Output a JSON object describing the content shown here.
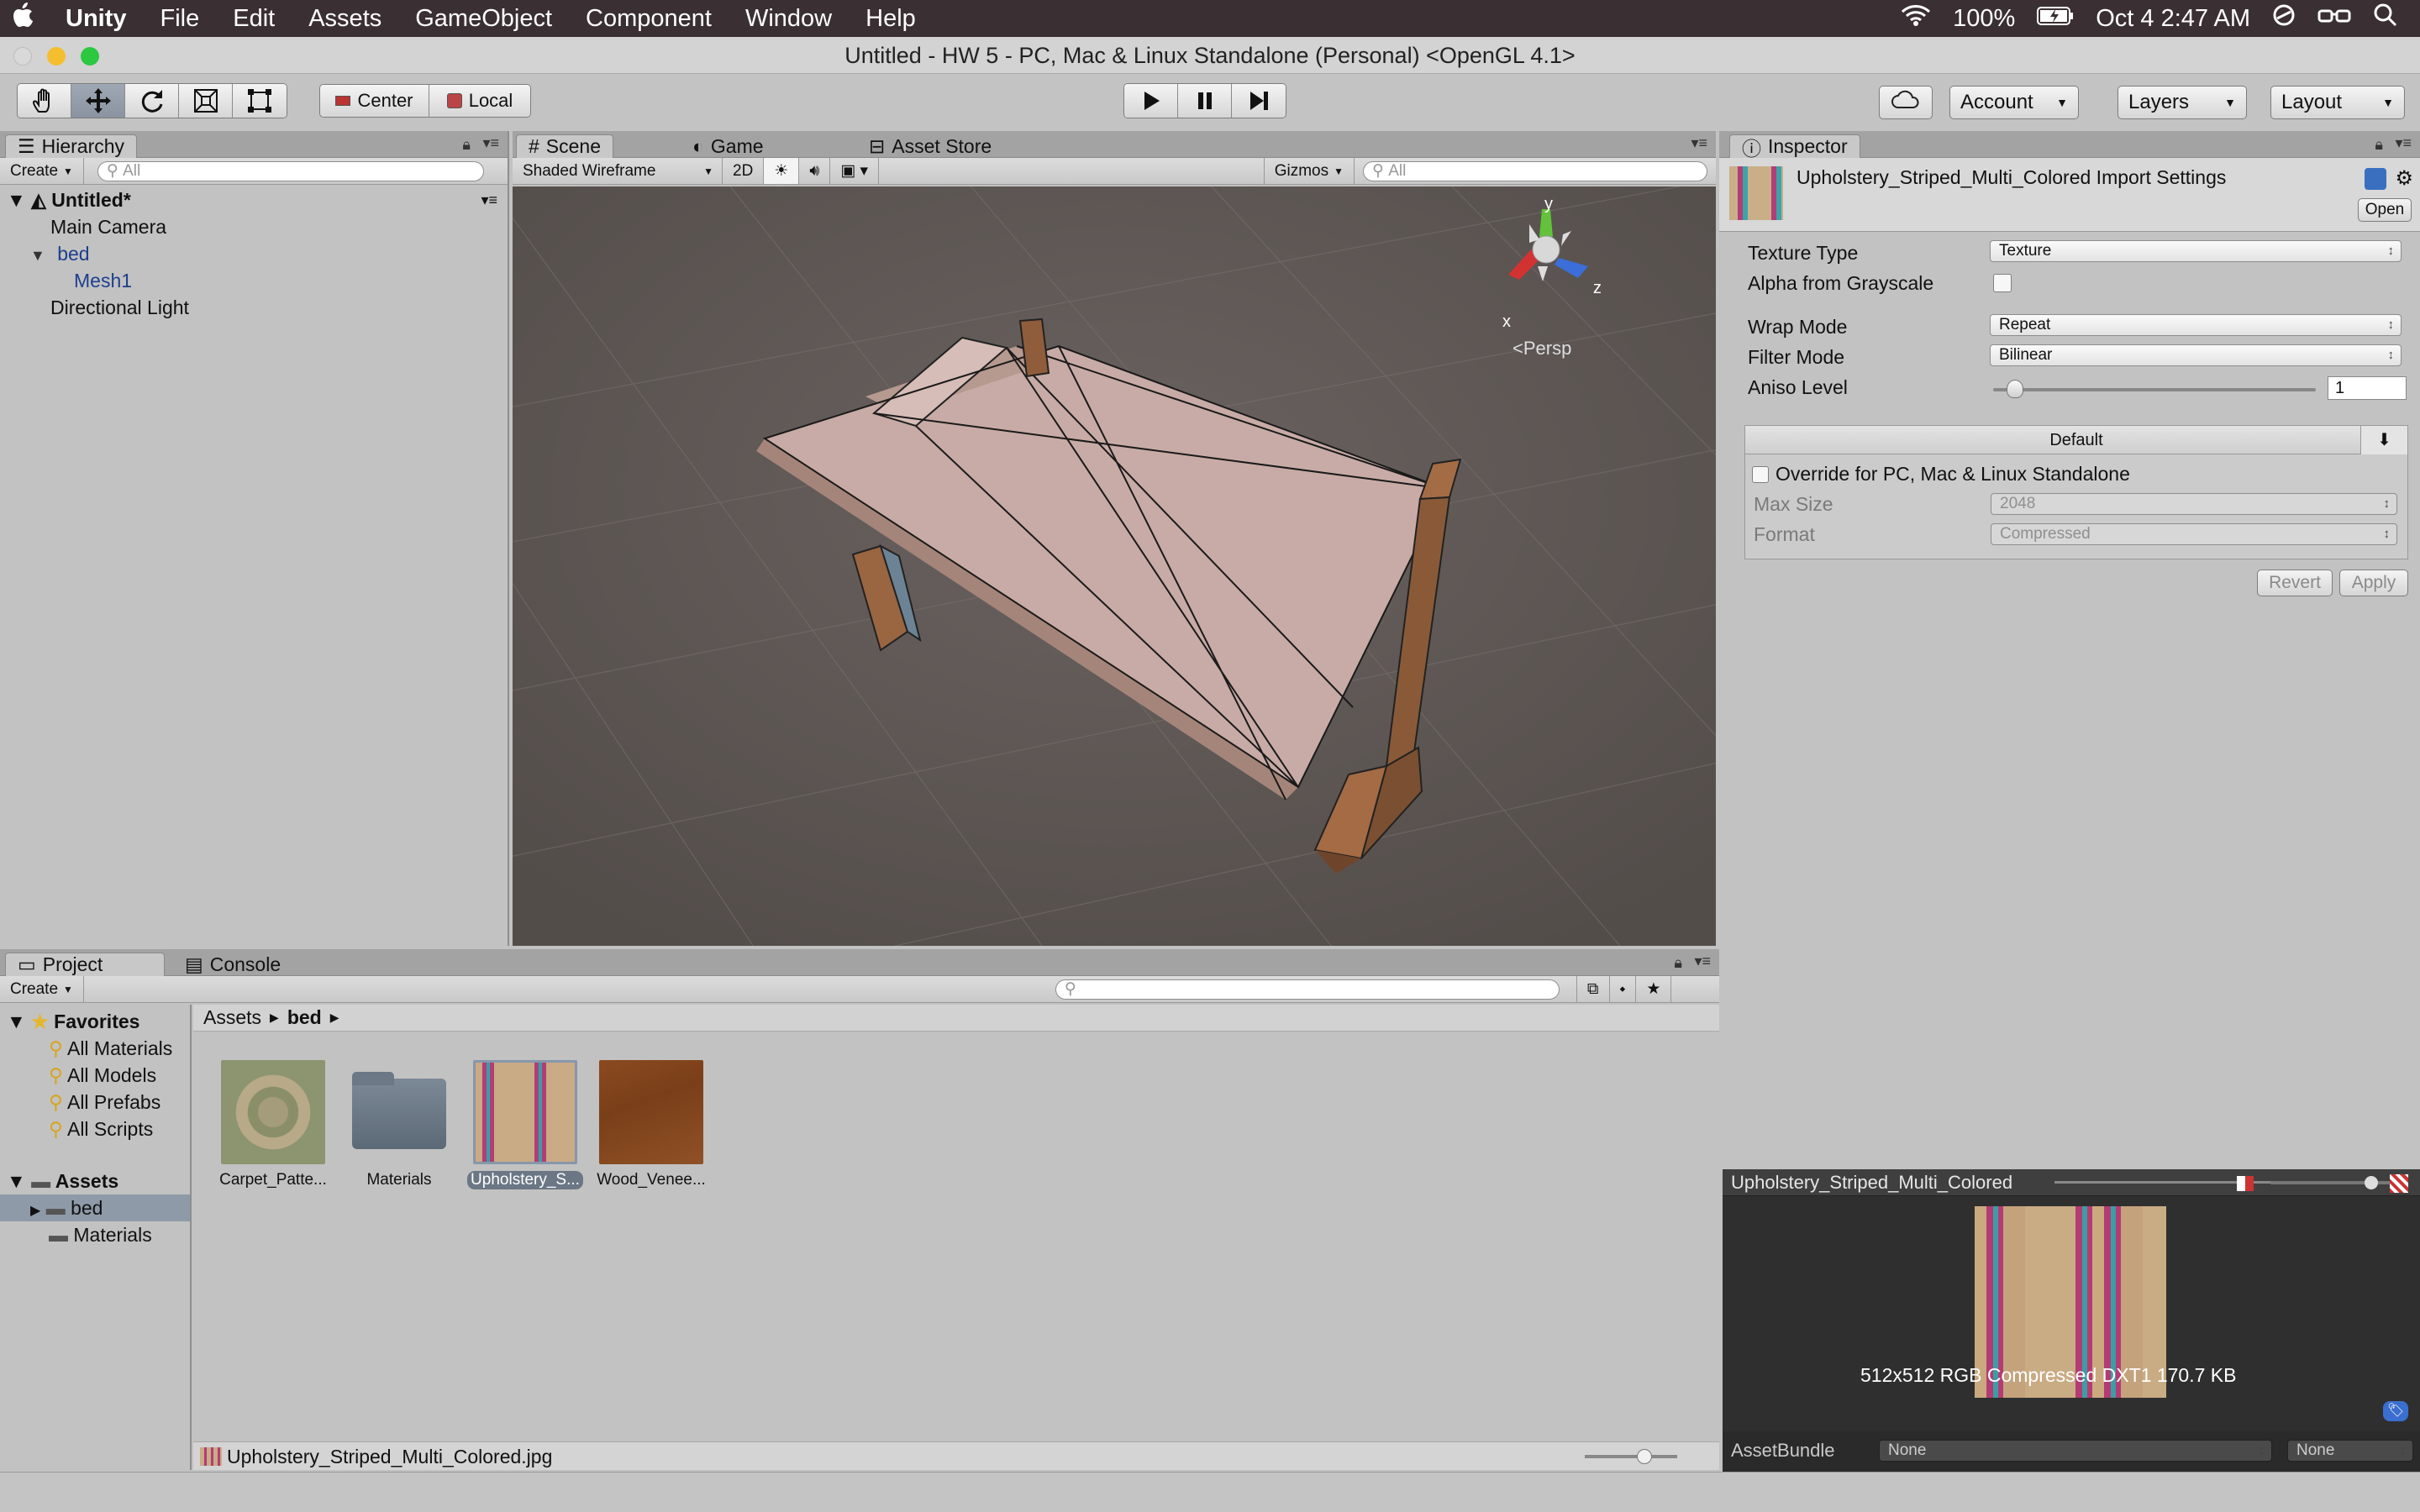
{
  "menubar": {
    "apple": "",
    "app": "Unity",
    "items": [
      "File",
      "Edit",
      "Assets",
      "GameObject",
      "Component",
      "Window",
      "Help"
    ],
    "battery": "100%",
    "clock": "Oct 4  2:47 AM"
  },
  "window": {
    "title": "Untitled - HW 5 - PC, Mac & Linux Standalone (Personal) <OpenGL 4.1>"
  },
  "toolbar": {
    "center_label": "Center",
    "local_label": "Local",
    "account_label": "Account",
    "layers_label": "Layers",
    "layout_label": "Layout"
  },
  "hierarchy": {
    "tab": "Hierarchy",
    "create": "Create",
    "search_placeholder": "All",
    "scene": "Untitled*",
    "items": {
      "main_camera": "Main Camera",
      "bed": "bed",
      "mesh1": "Mesh1",
      "light": "Directional Light"
    }
  },
  "scene": {
    "tabs": {
      "scene": "Scene",
      "game": "Game",
      "store": "Asset Store"
    },
    "shading": "Shaded Wireframe",
    "mode2d": "2D",
    "gizmos": "Gizmos",
    "search_placeholder": "All",
    "gizmo": {
      "y": "y",
      "x": "x",
      "z": "z",
      "persp": "Persp"
    }
  },
  "inspector": {
    "tab": "Inspector",
    "title": "Upholstery_Striped_Multi_Colored  Import Settings",
    "open": "Open",
    "texture_type_label": "Texture Type",
    "texture_type_value": "Texture",
    "alpha_label": "Alpha from Grayscale",
    "wrap_label": "Wrap Mode",
    "wrap_value": "Repeat",
    "filter_label": "Filter Mode",
    "filter_value": "Bilinear",
    "aniso_label": "Aniso Level",
    "aniso_value": "1",
    "platform_header": "Default",
    "override_label": "Override for PC, Mac & Linux Standalone",
    "max_size_label": "Max Size",
    "max_size_value": "2048",
    "format_label": "Format",
    "format_value": "Compressed",
    "revert": "Revert",
    "apply": "Apply"
  },
  "preview": {
    "title": "Upholstery_Striped_Multi_Colored",
    "info": "512x512  RGB Compressed DXT1    170.7 KB",
    "assetbundle_label": "AssetBundle",
    "bundle_value": "None",
    "variant_value": "None"
  },
  "project": {
    "tabs": {
      "project": "Project",
      "console": "Console"
    },
    "create": "Create",
    "favorites": "Favorites",
    "fav_items": [
      "All Materials",
      "All Models",
      "All Prefabs",
      "All Scripts"
    ],
    "assets_root": "Assets",
    "asset_folders": [
      "bed",
      "Materials"
    ],
    "breadcrumb": {
      "root": "Assets",
      "current": "bed"
    },
    "assets": [
      "Carpet_Patte...",
      "Materials",
      "Upholstery_S...",
      "Wood_Venee..."
    ],
    "selected_file": "Upholstery_Striped_Multi_Colored.jpg"
  },
  "colors": {
    "accent_select": "#3e5f96",
    "scene_bg": "#58524f",
    "menubar": "#3a2f33"
  }
}
